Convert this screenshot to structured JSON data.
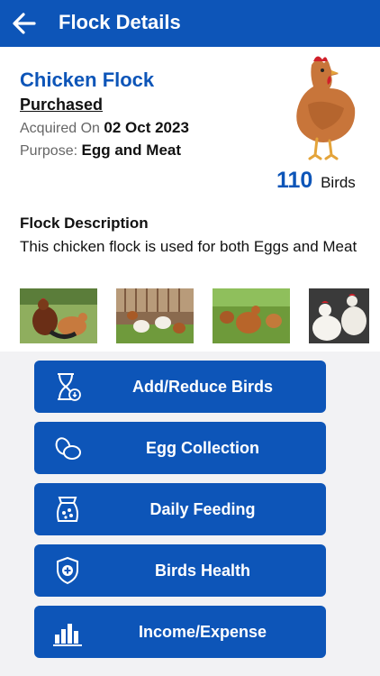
{
  "header": {
    "title": "Flock Details",
    "back_icon": "arrow-left-icon"
  },
  "flock": {
    "name": "Chicken Flock",
    "type": "Purchased",
    "acquired_label": "Acquired On",
    "acquired_value": "02 Oct 2023",
    "purpose_label": "Purpose:",
    "purpose_value": "Egg and Meat",
    "bird_count": "110",
    "bird_unit": "Birds"
  },
  "description": {
    "title": "Flock Description",
    "text": "This chicken flock is used for both Eggs and Meat"
  },
  "photos": [
    "rooster-and-hen-photo",
    "chickens-in-yard-photo",
    "hens-on-grass-photo",
    "white-hens-photo"
  ],
  "actions": [
    {
      "label": "Add/Reduce Birds",
      "icon": "hourglass-icon"
    },
    {
      "label": "Egg Collection",
      "icon": "eggs-icon"
    },
    {
      "label": "Daily Feeding",
      "icon": "feed-bag-icon"
    },
    {
      "label": "Birds Health",
      "icon": "shield-plus-icon"
    },
    {
      "label": "Income/Expense",
      "icon": "bar-chart-icon"
    }
  ],
  "colors": {
    "primary": "#0d55b8",
    "background": "#f2f2f4"
  }
}
